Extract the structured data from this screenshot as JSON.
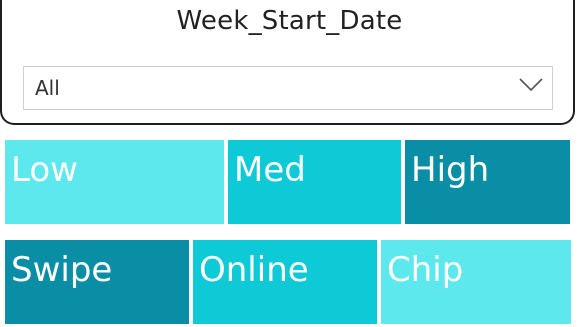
{
  "slicer": {
    "title": "Week_Start_Date",
    "selected": "All"
  },
  "tiles_row1": [
    {
      "label": "Low",
      "color": "#5ce8ec"
    },
    {
      "label": "Med",
      "color": "#0dcad6"
    },
    {
      "label": "High",
      "color": "#0a8ea5"
    }
  ],
  "tiles_row2": [
    {
      "label": "Swipe",
      "color": "#0a8ea5"
    },
    {
      "label": "Online",
      "color": "#0dcad6"
    },
    {
      "label": "Chip",
      "color": "#5ce8ec"
    }
  ],
  "icons": {
    "dropdown": "chevron-down-icon"
  }
}
